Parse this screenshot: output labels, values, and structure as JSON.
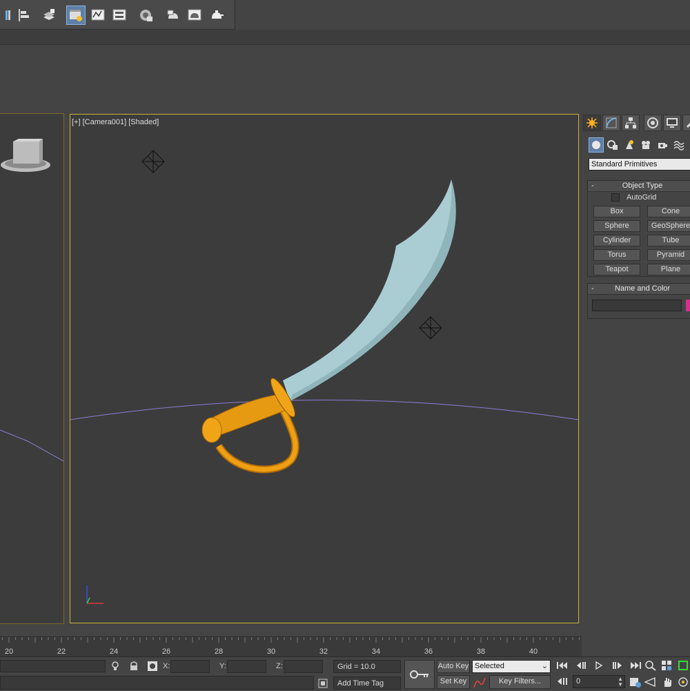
{
  "viewport": {
    "label": "[+] [Camera001] [Shaded]"
  },
  "toolbar": {
    "icons": [
      "viewport-layout-icon",
      "align-icon",
      "layer-manager-icon",
      "scene-explorer-icon",
      "curve-editor-icon",
      "schematic-view-icon",
      "material-editor-icon",
      "render-setup-icon",
      "rendered-frame-icon",
      "render-icon"
    ]
  },
  "command_panel": {
    "tabs": [
      "create-icon",
      "modify-icon",
      "hierarchy-icon",
      "motion-icon",
      "display-icon",
      "utilities-icon"
    ],
    "category_dropdown": "Standard Primitives",
    "object_type": {
      "title": "Object Type",
      "autogrid_label": "AutoGrid",
      "buttons": [
        "Box",
        "Cone",
        "Sphere",
        "GeoSphere",
        "Cylinder",
        "Tube",
        "Torus",
        "Pyramid",
        "Teapot",
        "Plane"
      ]
    },
    "name_color": {
      "title": "Name and Color",
      "name_value": "",
      "swatch_color": "#d82e8c"
    }
  },
  "timeline": {
    "ticks": [
      "20",
      "22",
      "24",
      "26",
      "28",
      "30",
      "32",
      "34",
      "36",
      "38",
      "40"
    ]
  },
  "status": {
    "x_label": "X:",
    "y_label": "Y:",
    "z_label": "Z:",
    "grid": "Grid = 10.0",
    "add_time_tag": "Add Time Tag",
    "auto_key": "Auto Key",
    "set_key": "Set Key",
    "selected": "Selected",
    "key_filters": "Key Filters...",
    "frame": "0"
  },
  "colors": {
    "viewport_border_active": "#c9b538",
    "blade": "#a9cdd3",
    "hilt": "#e69a12",
    "horizon": "#8a7fd6"
  }
}
